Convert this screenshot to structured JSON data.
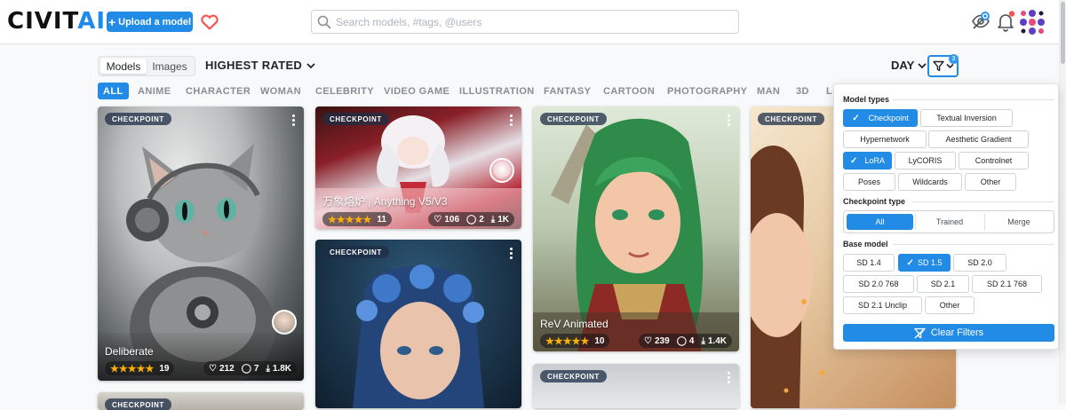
{
  "header": {
    "logo_main": "CIVIT",
    "logo_accent": "AI",
    "upload_label": "Upload a model",
    "search_placeholder": "Search models, #tags, @users"
  },
  "toolbar": {
    "view_options": [
      "Models",
      "Images"
    ],
    "view_selected": "Models",
    "sort_label": "HIGHEST RATED",
    "period_label": "DAY",
    "filter_count": "3"
  },
  "tags": [
    "ALL",
    "ANIME",
    "CHARACTER",
    "WOMAN",
    "CELEBRITY",
    "VIDEO GAME",
    "ILLUSTRATION",
    "FANTASY",
    "CARTOON",
    "PHOTOGRAPHY",
    "MAN",
    "3D",
    "L"
  ],
  "tag_selected": "ALL",
  "cards": [
    {
      "badge": "CHECKPOINT",
      "title": "Deliberate",
      "stars": "★★★★★",
      "rating_count": "19",
      "likes": "212",
      "comments": "7",
      "downloads": "1.8K"
    },
    {
      "badge": "CHECKPOINT",
      "title": "万象熔炉 | Anything V5/V3",
      "stars": "★★★★★",
      "rating_count": "11",
      "likes": "106",
      "comments": "2",
      "downloads": "1K"
    },
    {
      "badge": "CHECKPOINT",
      "title": "ReV Animated",
      "stars": "★★★★★",
      "rating_count": "10",
      "likes": "239",
      "comments": "4",
      "downloads": "1.4K"
    },
    {
      "badge": "CHECKPOINT"
    },
    {
      "badge": "CHECKPOINT"
    },
    {
      "badge": "CHECKPOINT"
    },
    {
      "badge": "CHECKPOINT"
    }
  ],
  "filters": {
    "model_types_title": "Model types",
    "model_types": [
      {
        "label": "Checkpoint",
        "selected": true
      },
      {
        "label": "Textual Inversion",
        "selected": false
      },
      {
        "label": "Hypernetwork",
        "selected": false
      },
      {
        "label": "Aesthetic Gradient",
        "selected": false
      },
      {
        "label": "LoRA",
        "selected": true
      },
      {
        "label": "LyCORIS",
        "selected": false
      },
      {
        "label": "Controlnet",
        "selected": false
      },
      {
        "label": "Poses",
        "selected": false
      },
      {
        "label": "Wildcards",
        "selected": false
      },
      {
        "label": "Other",
        "selected": false
      }
    ],
    "checkpoint_type_title": "Checkpoint type",
    "checkpoint_types": [
      "All",
      "Trained",
      "Merge"
    ],
    "checkpoint_type_selected": "All",
    "base_model_title": "Base model",
    "base_models": [
      {
        "label": "SD 1.4",
        "selected": false
      },
      {
        "label": "SD 1.5",
        "selected": true
      },
      {
        "label": "SD 2.0",
        "selected": false
      },
      {
        "label": "SD 2.0 768",
        "selected": false
      },
      {
        "label": "SD 2.1",
        "selected": false
      },
      {
        "label": "SD 2.1 768",
        "selected": false
      },
      {
        "label": "SD 2.1 Unclip",
        "selected": false
      },
      {
        "label": "Other",
        "selected": false
      }
    ],
    "clear_label": "Clear Filters"
  },
  "colors": {
    "accent": "#228be6",
    "star": "#fab005",
    "notification_dot": "#fa5252"
  }
}
